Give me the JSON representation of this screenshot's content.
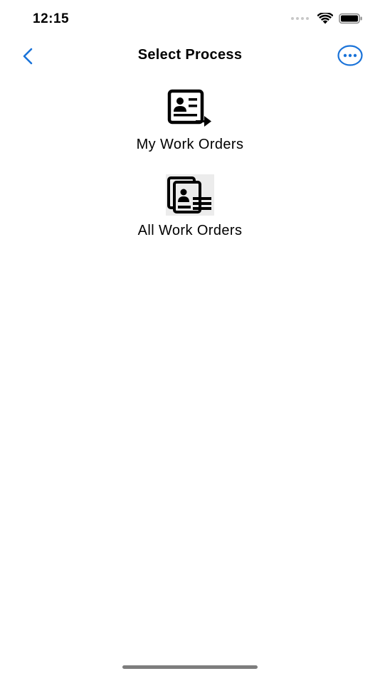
{
  "status_bar": {
    "time": "12:15",
    "icons": [
      "signal-dots-icon",
      "wifi-icon",
      "battery-icon"
    ]
  },
  "nav": {
    "title": "Select Process",
    "back_icon": "chevron-left-icon",
    "more_icon": "more-options-icon"
  },
  "processes": [
    {
      "label": "My Work Orders",
      "icon": "my-work-orders-icon"
    },
    {
      "label": "All Work Orders",
      "icon": "all-work-orders-icon"
    }
  ],
  "colors": {
    "accent": "#1a73d9",
    "text": "#000000",
    "background": "#ffffff"
  }
}
